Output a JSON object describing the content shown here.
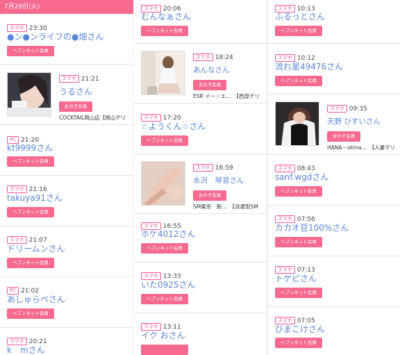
{
  "date_header": "7月29日(火)",
  "col1": [
    {
      "type": "スマホ",
      "time": "23:30",
      "name": "●ン●ンライフの●畑さん",
      "pill": "ヘブンネット会員"
    },
    {
      "type": "スマホ",
      "time": "21:21",
      "name": "うるさん",
      "pill": "女の子会員",
      "info": "COCKTAIL岡山店【岡山デリ"
    },
    {
      "type": "PC",
      "time": "21:20",
      "name": "kt9999さん",
      "pill": "ヘブンネット会員"
    },
    {
      "type": "スマホ",
      "time": "21:16",
      "name": "takuya91さん",
      "pill": "ヘブンネット会員"
    },
    {
      "type": "スマホ",
      "time": "21:07",
      "name": "ドリームンさん",
      "pill": "ヘブンネット会員"
    },
    {
      "type": "PC",
      "time": "21:02",
      "name": "あしゅらぺさん",
      "pill": "ヘブンネット会員"
    },
    {
      "type": "スマホ",
      "time": "20:21",
      "name": "k　mさん"
    }
  ],
  "col2": [
    {
      "type": "スマホ",
      "time": "20:06",
      "name": "むんなぁさん",
      "pill": "ヘブンネット会員"
    },
    {
      "type": "スマホ",
      "time": "18:24",
      "name": "あんなさん",
      "pill": "女の子会員",
      "info": "ESR イー・エ…　【西部デリ"
    },
    {
      "type": "スマホ",
      "time": "17:20",
      "name": "☆ようくん☆さん",
      "pill": "ヘブンネット会員"
    },
    {
      "type": "スマホ",
      "time": "16:59",
      "name": "水沢　琴音さん",
      "pill": "女の子会員",
      "info": "SM東京　新…　【派遣型SM"
    },
    {
      "type": "スマホ",
      "time": "16:55",
      "name": "ホケ4012さん",
      "pill": "ヘブンネット会員"
    },
    {
      "type": "スマホ",
      "time": "13:33",
      "name": "いた0925さん",
      "pill": "ヘブンネット会員"
    },
    {
      "type": "スマホ",
      "time": "13:11",
      "name": "イク おさん"
    }
  ],
  "col3": [
    {
      "type": "スマホ",
      "time": "10:13",
      "name": "ふるっとさん",
      "pill": "ヘブンネット会員"
    },
    {
      "type": "スマホ",
      "time": "10:12",
      "name": "流れ星49476さん",
      "pill": "ヘブンネット会員"
    },
    {
      "type": "スマホ",
      "time": "09:35",
      "name": "天野 ひすいさん",
      "pill": "女の子会員",
      "info": "HANA－okina…　【人妻デリ"
    },
    {
      "type": "スマホ",
      "time": "08:43",
      "name": "sanf.wgdさん",
      "pill": "ヘブンネット会員"
    },
    {
      "type": "スマホ",
      "time": "07:56",
      "name": "カカオ豆100%さん",
      "pill": "ヘブンネット会員"
    },
    {
      "type": "スマホ",
      "time": "07:13",
      "name": "トゲピさん",
      "pill": "ヘブンネット会員"
    },
    {
      "type": "スマホ",
      "time": "07:05",
      "name": "ひまこけさん",
      "pill": "ヘブンネット会員"
    }
  ],
  "colors": {
    "accent": "#f66a8f",
    "badge": "#f0559a",
    "name": "#5a86d6"
  }
}
